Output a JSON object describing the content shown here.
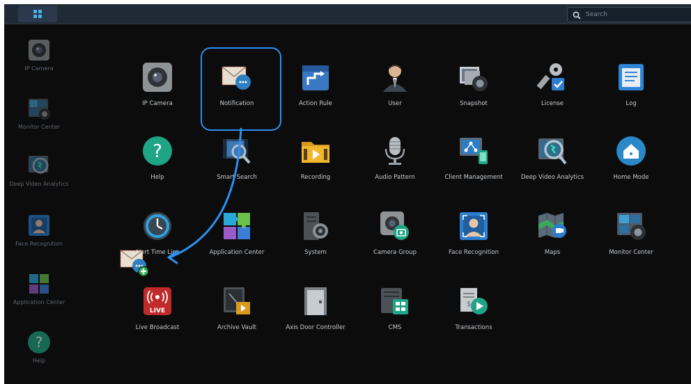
{
  "toolbar": {
    "search_placeholder": "Search"
  },
  "dock": {
    "items": [
      {
        "label": "IP Camera",
        "icon": "ip-camera-icon"
      },
      {
        "label": "Monitor Center",
        "icon": "monitor-center-icon"
      },
      {
        "label": "Deep Video Analytics",
        "icon": "deep-video-analytics-icon"
      },
      {
        "label": "Face Recognition",
        "icon": "face-recognition-icon"
      },
      {
        "label": "Application Center",
        "icon": "application-center-icon"
      },
      {
        "label": "Help",
        "icon": "help-icon"
      }
    ]
  },
  "apps": [
    {
      "label": "IP Camera",
      "icon": "ip-camera-icon"
    },
    {
      "label": "Notification",
      "icon": "notification-icon"
    },
    {
      "label": "Action Rule",
      "icon": "action-rule-icon"
    },
    {
      "label": "User",
      "icon": "user-icon"
    },
    {
      "label": "Snapshot",
      "icon": "snapshot-icon"
    },
    {
      "label": "License",
      "icon": "license-icon"
    },
    {
      "label": "Log",
      "icon": "log-icon"
    },
    {
      "label": "Help",
      "icon": "help-icon"
    },
    {
      "label": "Smart Search",
      "icon": "smart-search-icon"
    },
    {
      "label": "Recording",
      "icon": "recording-icon"
    },
    {
      "label": "Audio Pattern",
      "icon": "audio-pattern-icon"
    },
    {
      "label": "Client Management",
      "icon": "client-management-icon"
    },
    {
      "label": "Deep Video Analytics",
      "icon": "deep-video-analytics-icon"
    },
    {
      "label": "Home Mode",
      "icon": "home-mode-icon"
    },
    {
      "label": "Alert Time Line",
      "icon": "alert-time-line-icon"
    },
    {
      "label": "Application Center",
      "icon": "application-center-icon"
    },
    {
      "label": "System",
      "icon": "system-icon"
    },
    {
      "label": "Camera Group",
      "icon": "camera-group-icon"
    },
    {
      "label": "Face Recognition",
      "icon": "face-recognition-icon"
    },
    {
      "label": "Maps",
      "icon": "maps-icon"
    },
    {
      "label": "Monitor Center",
      "icon": "monitor-center-icon"
    },
    {
      "label": "Live Broadcast",
      "icon": "live-broadcast-icon"
    },
    {
      "label": "Archive Vault",
      "icon": "archive-vault-icon"
    },
    {
      "label": "Axis Door Controller",
      "icon": "axis-door-controller-icon"
    },
    {
      "label": "CMS",
      "icon": "cms-icon"
    },
    {
      "label": "Transactions",
      "icon": "transactions-icon"
    }
  ],
  "live_badge_text": "LIVE",
  "colors": {
    "accent": "#2e8ff0",
    "topbar": "#1f2a36",
    "background": "#0c0c0c"
  }
}
